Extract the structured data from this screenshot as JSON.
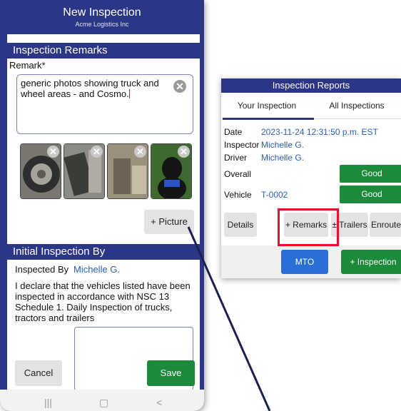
{
  "phone": {
    "title": "New Inspection",
    "subtitle": "Acme Logistics Inc",
    "remarks": {
      "header": "Inspection Remarks",
      "label": "Remark*",
      "value": "generic photos showing truck and wheel areas - and Cosmo."
    },
    "add_picture_label": "+ Picture",
    "initial": {
      "header": "Initial Inspection By",
      "inspected_by_label": "Inspected By",
      "inspected_by_value": "Michelle G.",
      "declaration": "I declare that the vehicles listed have been inspected in accordance with NSC 13 Schedule 1. Daily Inspection of trucks, tractors and trailers"
    },
    "cancel_label": "Cancel",
    "save_label": "Save",
    "nav": {
      "recents": "|||",
      "home": "▢",
      "back": "<"
    }
  },
  "reports": {
    "title": "Inspection Reports",
    "tabs": [
      "Your Inspection",
      "All Inspections"
    ],
    "date_label": "Date",
    "date_value": "2023-11-24 12:31:50 p.m. EST",
    "inspector_label": "Inspector",
    "inspector_value": "Michelle G.",
    "driver_label": "Driver",
    "driver_value": "Michelle G.",
    "overall_label": "Overall",
    "overall_status": "Good",
    "vehicle_label": "Vehicle",
    "vehicle_value": "T-0002",
    "vehicle_status": "Good",
    "buttons": {
      "details": "Details",
      "remarks": "+ Remarks",
      "trailers": "± Trailers",
      "enroute": "Enroute"
    },
    "mto_label": "MTO",
    "add_inspection_label": "+ Inspection"
  },
  "colors": {
    "brand": "#2b3686",
    "good": "#1b8a3a",
    "mto": "#2b6fd6",
    "highlight": "#e4132b"
  }
}
